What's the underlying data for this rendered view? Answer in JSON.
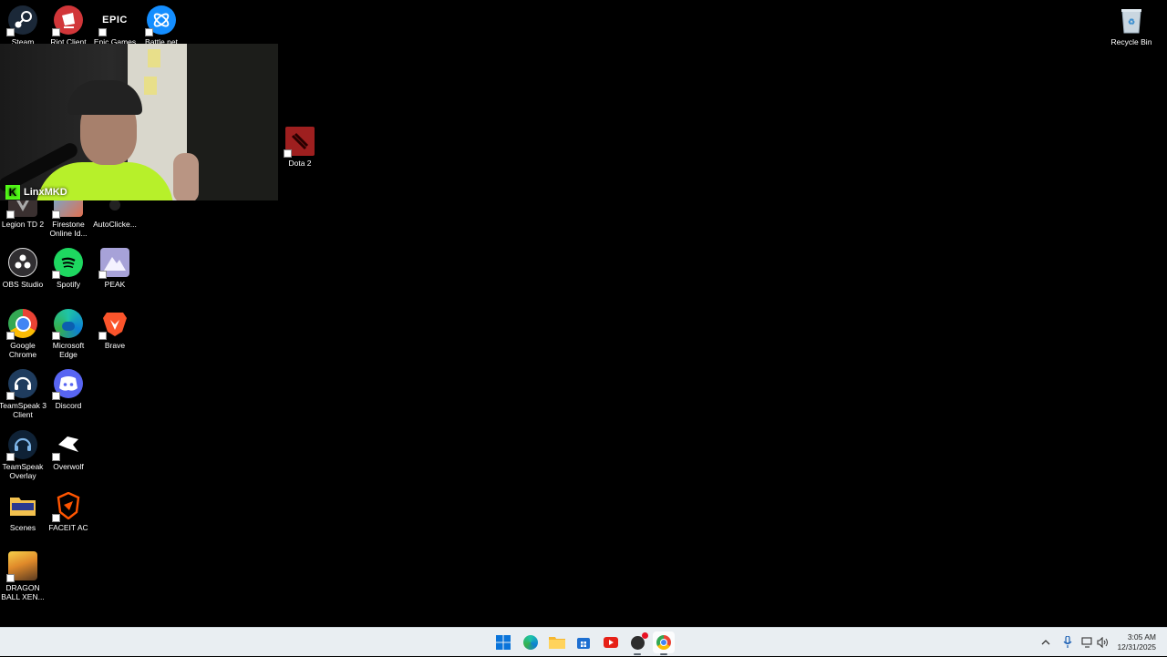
{
  "desktop": {
    "icons": [
      {
        "label": "Steam"
      },
      {
        "label": "Riot Client"
      },
      {
        "label": "Epic Games",
        "glyph": "EPIC"
      },
      {
        "label": "Battle.net"
      },
      {
        "label": "Recycle Bin"
      },
      {
        "label": "Dota 2"
      },
      {
        "label": "Legion TD 2"
      },
      {
        "label": "Firestone Online Id..."
      },
      {
        "label": "AutoClicke..."
      },
      {
        "label": "OBS Studio"
      },
      {
        "label": "Spotify"
      },
      {
        "label": "PEAK"
      },
      {
        "label": "Google Chrome"
      },
      {
        "label": "Microsoft Edge"
      },
      {
        "label": "Brave"
      },
      {
        "label": "TeamSpeak 3 Client"
      },
      {
        "label": "Discord"
      },
      {
        "label": "TeamSpeak Overlay"
      },
      {
        "label": "Overwolf"
      },
      {
        "label": "Scenes"
      },
      {
        "label": "FACEIT AC"
      },
      {
        "label": "DRAGON BALL XEN..."
      }
    ]
  },
  "webcam": {
    "streamer_name": "LinxMKD",
    "platform_glyph": "K",
    "platform_color": "#53fc18"
  },
  "taskbar": {
    "apps": [
      {
        "name": "start-button",
        "icon": "windows-logo-icon"
      },
      {
        "name": "edge-taskbar",
        "icon": "edge-icon"
      },
      {
        "name": "file-explorer-taskbar",
        "icon": "folder-icon"
      },
      {
        "name": "store-taskbar",
        "icon": "store-icon"
      },
      {
        "name": "youtube-taskbar",
        "icon": "youtube-icon"
      },
      {
        "name": "obs-taskbar",
        "icon": "obs-icon"
      },
      {
        "name": "chrome-taskbar",
        "icon": "chrome-icon",
        "active": true
      }
    ],
    "clock": {
      "time": "3:05 AM",
      "date": "12/31/2025"
    }
  },
  "colors": {
    "taskbar_bg": "#e9eef2",
    "desktop_bg": "#000000"
  }
}
